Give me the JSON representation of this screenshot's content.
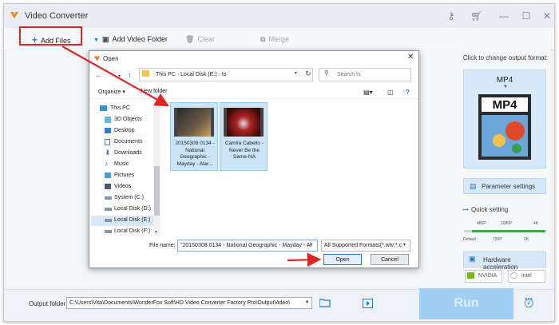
{
  "app": {
    "title": "Video Converter"
  },
  "toolbar": {
    "add_files": "Add Files",
    "add_video_folder": "Add Video Folder",
    "clear": "Clear",
    "merge": "Merge"
  },
  "right_panel": {
    "output_format_label": "Click to change output format:",
    "format_name": "MP4",
    "format_icon_text": "MP4",
    "parameter_settings": "Parameter settings",
    "quick_setting": "Quick setting",
    "ticks_top": [
      "480P",
      "1080P",
      "4K"
    ],
    "ticks_bottom": [
      "Default",
      "720P",
      "2K"
    ],
    "quality_level": 0.9,
    "hardware_acceleration": "Hardware acceleration",
    "brands": [
      "NVIDIA",
      "intel"
    ]
  },
  "bottom": {
    "output_folder_label": "Output folder:",
    "output_folder_path": "C:\\Users\\Vita\\Documents\\WonderFox Soft\\HD Video Converter Factory Pro\\OutputVideo\\",
    "run_label": "Run"
  },
  "dialog": {
    "title": "Open",
    "path": [
      "This PC",
      "Local Disk (E:)",
      "ts"
    ],
    "search_placeholder": "Search ts",
    "organize": "Organize ▾",
    "new_folder": "New folder",
    "nav_items": [
      "This PC",
      "3D Objects",
      "Desktop",
      "Documents",
      "Downloads",
      "Music",
      "Pictures",
      "Videos",
      "System (C:)",
      "Local Disk (D:)",
      "Local Disk (E:)",
      "Local Disk (F:)"
    ],
    "files": [
      {
        "name": "20150308 0134 - National Geographic - Mayday - Alar..."
      },
      {
        "name": "Camila Cabello - Never Be the Same-NA"
      }
    ],
    "file_name_label": "File name:",
    "file_name_value": "\"20150308 0134 - National Geographic - Mayday - Al",
    "filter_value": "All Supported Formats(*.wtv;*.c",
    "open_button": "Open",
    "cancel_button": "Cancel"
  },
  "colors": {
    "accent": "#2a76c6",
    "annotation_red": "#e02424",
    "run_bg": "#9fd0f3"
  }
}
